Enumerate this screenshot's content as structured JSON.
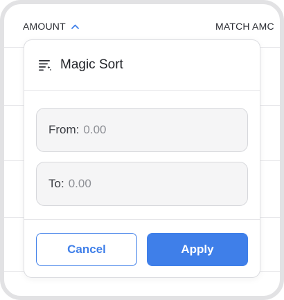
{
  "table": {
    "columns": [
      {
        "label": "AMOUNT",
        "sort": "ascending"
      },
      {
        "label": "MATCH AMC"
      }
    ]
  },
  "popover": {
    "title": "Magic Sort",
    "icon": "magic-sort-icon",
    "from": {
      "label": "From:",
      "value": "0.00"
    },
    "to": {
      "label": "To:",
      "value": "0.00"
    },
    "cancel_label": "Cancel",
    "apply_label": "Apply"
  },
  "colors": {
    "accent": "#3f7fe9",
    "border": "#d6d7db",
    "field_bg": "#f5f5f6"
  }
}
